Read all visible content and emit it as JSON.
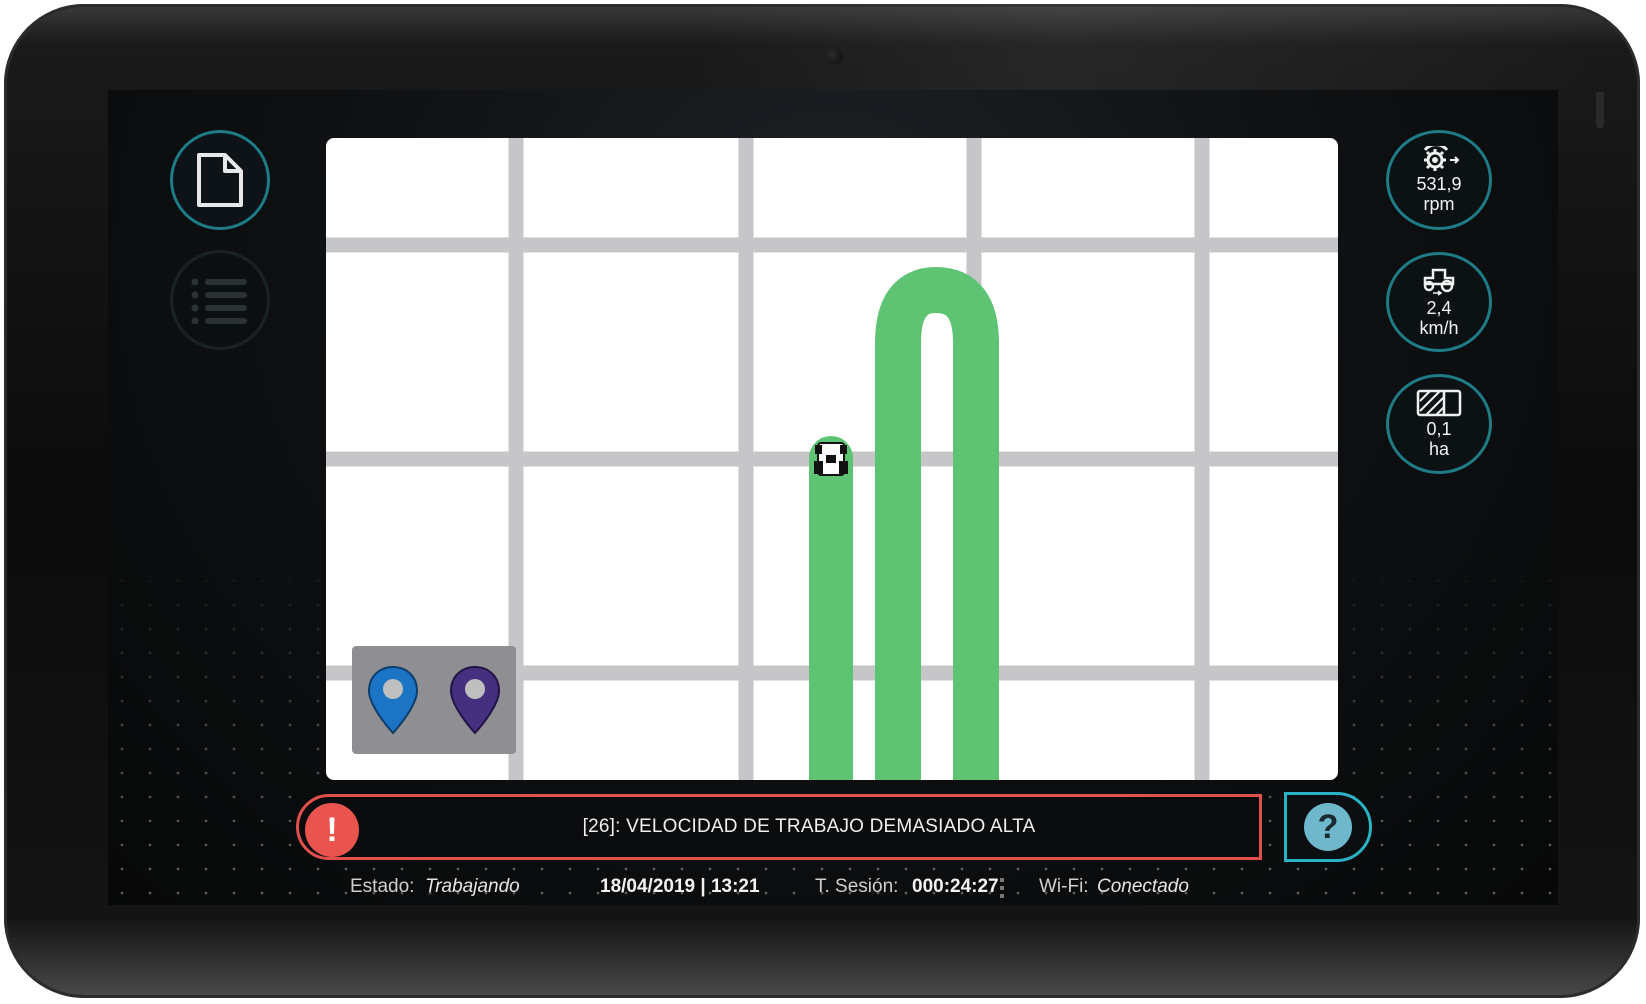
{
  "gauges": {
    "rpm": {
      "icon": "pto-gear-icon",
      "value": "531,9",
      "unit": "rpm"
    },
    "speed": {
      "icon": "tractor-speed-icon",
      "value": "2,4",
      "unit": "km/h"
    },
    "area": {
      "icon": "area-icon",
      "value": "0,1",
      "unit": "ha"
    }
  },
  "left_menu": {
    "file_icon": "document-icon",
    "list_icon": "list-icon"
  },
  "map": {
    "track_color": "#5ec473",
    "grid_color": "#c6c6c8",
    "markers": [
      {
        "name": "marker-a",
        "color": "#1c74c4"
      },
      {
        "name": "marker-b",
        "color": "#44307e"
      }
    ]
  },
  "alarm": {
    "icon": "!",
    "message": "[26]: VELOCIDAD DE TRABAJO DEMASIADO ALTA",
    "color": "#e2504c"
  },
  "help": {
    "label": "?"
  },
  "status": {
    "estado_label": "Estado:",
    "estado_value": "Trabajando",
    "datetime": "18/04/2019 | 13:21",
    "sesion_label": "T. Sesión:",
    "sesion_value": "000:24:27",
    "wifi_label": "Wi-Fi:",
    "wifi_value": "Conectado"
  }
}
